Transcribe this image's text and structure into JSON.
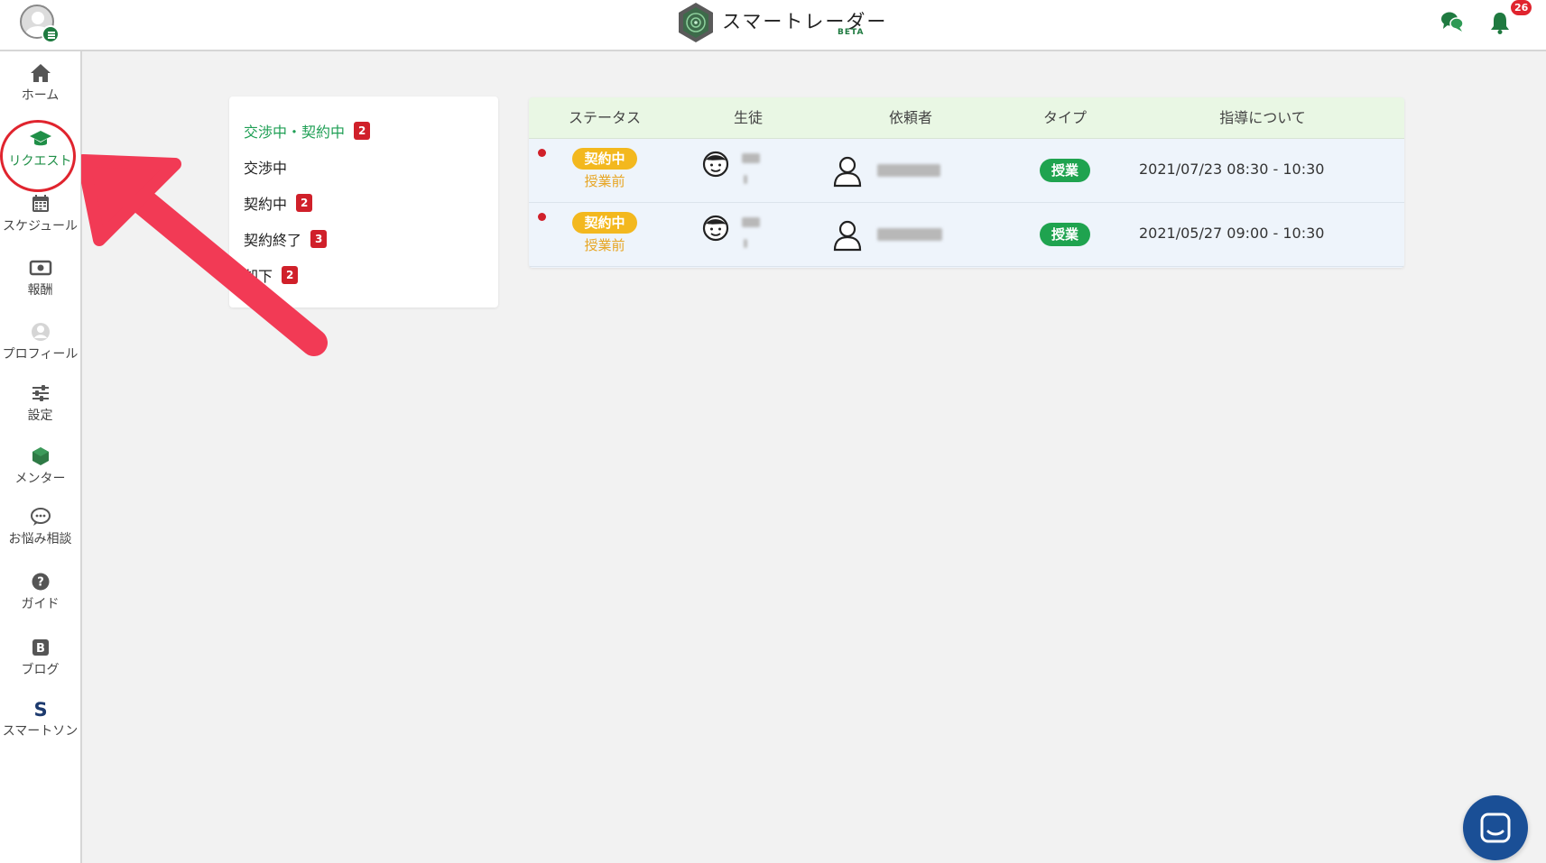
{
  "header": {
    "brand_name": "スマートレーダー",
    "brand_tag": "BETA",
    "notification_count": "26",
    "icons": [
      "user-avatar-icon",
      "menu-icon",
      "radar-logo-icon",
      "chat-bubbles-icon",
      "bell-icon"
    ]
  },
  "sidebar": {
    "items": [
      {
        "label": "ホーム",
        "icon": "home-icon"
      },
      {
        "label": "リクエスト",
        "icon": "graduation-cap-icon",
        "active": true
      },
      {
        "label": "スケジュール",
        "icon": "calendar-icon"
      },
      {
        "label": "報酬",
        "icon": "money-icon"
      },
      {
        "label": "プロフィール",
        "icon": "profile-icon"
      },
      {
        "label": "設定",
        "icon": "sliders-icon"
      },
      {
        "label": "メンター",
        "icon": "hexagon-icon"
      },
      {
        "label": "お悩み相談",
        "icon": "speech-bubble-icon"
      },
      {
        "label": "ガイド",
        "icon": "help-icon"
      },
      {
        "label": "ブログ",
        "icon": "blog-icon"
      },
      {
        "label": "スマートソン",
        "icon": "smartthon-s-icon"
      }
    ]
  },
  "filters": [
    {
      "label": "交渉中・契約中",
      "count": "2",
      "active": true
    },
    {
      "label": "交渉中",
      "count": null
    },
    {
      "label": "契約中",
      "count": "2"
    },
    {
      "label": "契約終了",
      "count": "3"
    },
    {
      "label": "却下",
      "count": "2"
    }
  ],
  "table": {
    "columns": [
      "ステータス",
      "生徒",
      "依頼者",
      "タイプ",
      "指導について"
    ],
    "rows": [
      {
        "status": "契約中",
        "sub_status": "授業前",
        "type": "授業",
        "schedule": "2021/07/23 08:30 - 10:30",
        "unread": true
      },
      {
        "status": "契約中",
        "sub_status": "授業前",
        "type": "授業",
        "schedule": "2021/05/27 09:00 - 10:30",
        "unread": true
      }
    ]
  },
  "colors": {
    "brand_green": "#1f8f47",
    "badge_red": "#d0202a",
    "status_yellow": "#f3b81e",
    "type_green": "#1fa34f",
    "header_row": "#e9f7e4",
    "annotation_red": "#f23a55",
    "support_chat_blue": "#1a4f96"
  }
}
